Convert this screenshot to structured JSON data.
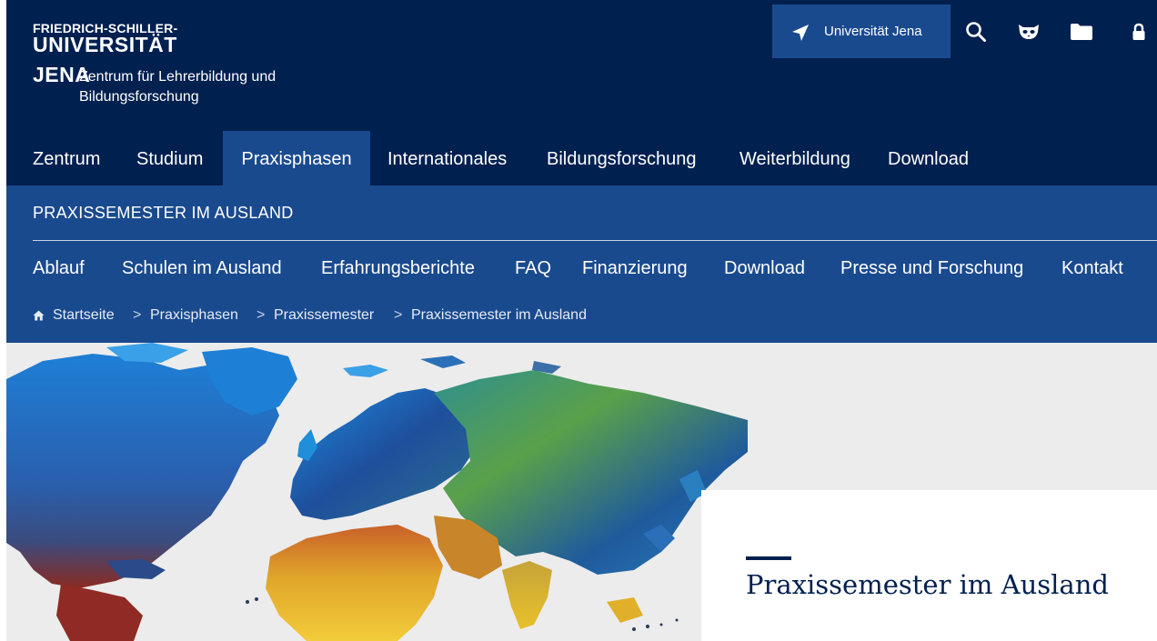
{
  "header": {
    "logo_line1": "FRIEDRICH-SCHILLER-",
    "logo_line2": "UNIVERSITÄT",
    "logo_line3": "JENA",
    "logo_sub_line1": "Zentrum für Lehrerbildung und",
    "logo_sub_line2": "Bildungsforschung",
    "location_label": "Universität Jena",
    "icons": [
      "location-arrow-icon",
      "search-icon",
      "mask-icon",
      "folder-icon",
      "lock-icon"
    ]
  },
  "main_nav": {
    "items": [
      {
        "label": "Zentrum"
      },
      {
        "label": "Studium"
      },
      {
        "label": "Praxisphasen",
        "active": true
      },
      {
        "label": "Internationales"
      },
      {
        "label": "Bildungsforschung"
      },
      {
        "label": "Weiterbildung"
      },
      {
        "label": "Download"
      }
    ]
  },
  "section": {
    "title": "PRAXISSEMESTER IM AUSLAND",
    "sub_nav": [
      {
        "label": "Ablauf"
      },
      {
        "label": "Schulen im Ausland"
      },
      {
        "label": "Erfahrungsberichte"
      },
      {
        "label": "FAQ"
      },
      {
        "label": "Finanzierung"
      },
      {
        "label": "Download"
      },
      {
        "label": "Presse und Forschung"
      },
      {
        "label": "Kontakt"
      }
    ]
  },
  "breadcrumb": {
    "home_icon": "home-icon",
    "items": [
      "Startseite",
      "Praxisphasen",
      "Praxissemester",
      "Praxissemester im Ausland"
    ],
    "separator": ">"
  },
  "hero": {
    "image": "painted-world-map",
    "title": "Praxissemester im Ausland"
  },
  "colors": {
    "header_bg": "#002050",
    "section_bg": "#1a4a8e",
    "hero_bg": "#ececec",
    "title_color": "#002050"
  }
}
